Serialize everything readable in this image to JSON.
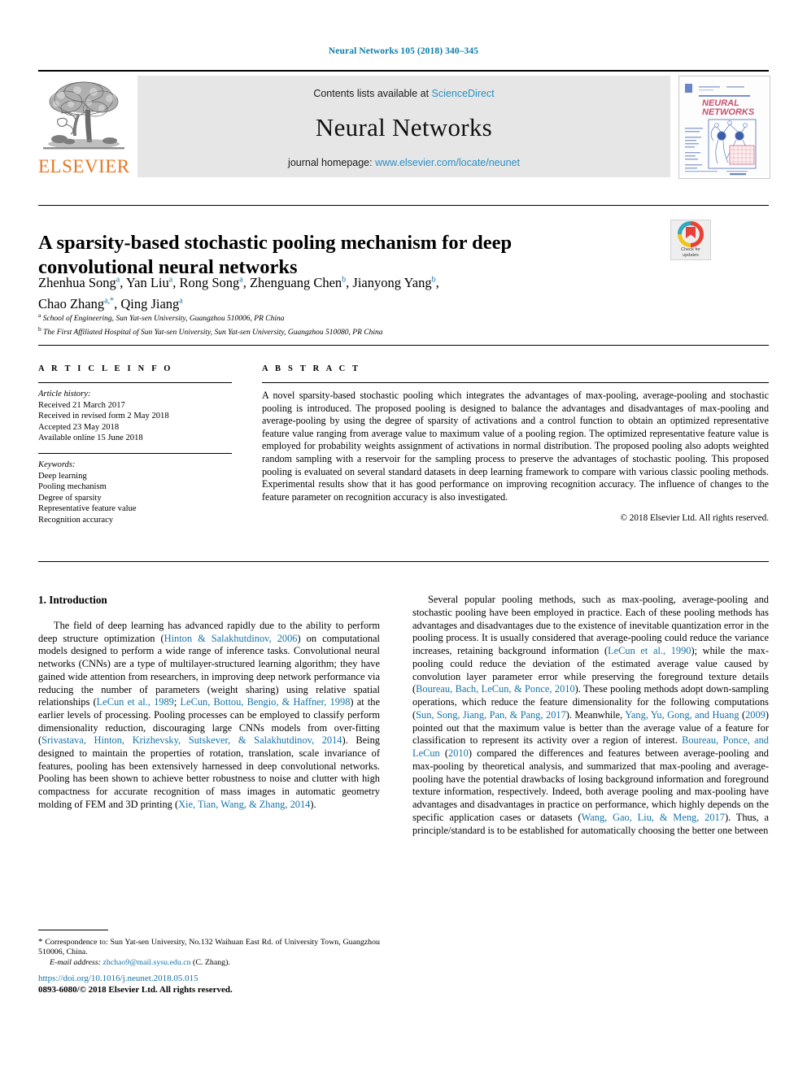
{
  "running_head": "Neural Networks 105 (2018) 340–345",
  "masthead": {
    "publisher_name": "ELSEVIER",
    "contents_prefix": "Contents lists available at",
    "contents_link": "ScienceDirect",
    "journal_title": "Neural Networks",
    "homepage_prefix": "journal homepage:",
    "homepage_link": "www.elsevier.com/locate/neunet",
    "cover": {
      "title_line1": "NEURAL",
      "title_line2": "NETWORKS",
      "accent_color": "#c94f6d",
      "frame_color": "#6b86c4"
    }
  },
  "title": "A sparsity-based stochastic pooling mechanism for deep convolutional neural networks",
  "authors_line1": "Zhenhua Song a, Yan Liu a, Rong Song a, Zhenguang Chen b, Jianyong Yang b,",
  "authors_line2": "Chao Zhang a,*, Qing Jiang a",
  "authors": [
    {
      "name": "Zhenhua Song",
      "marks": "a"
    },
    {
      "name": "Yan Liu",
      "marks": "a"
    },
    {
      "name": "Rong Song",
      "marks": "a"
    },
    {
      "name": "Zhenguang Chen",
      "marks": "b"
    },
    {
      "name": "Jianyong Yang",
      "marks": "b"
    },
    {
      "name": "Chao Zhang",
      "marks": "a,*"
    },
    {
      "name": "Qing Jiang",
      "marks": "a"
    }
  ],
  "affiliations": [
    {
      "mark": "a",
      "text": "School of Engineering, Sun Yat-sen University, Guangzhou 510006, PR China"
    },
    {
      "mark": "b",
      "text": "The First Affiliated Hospital of Sun Yat-sen University, Sun Yat-sen University, Guangzhou 510080, PR China"
    }
  ],
  "crossmark": {
    "label_line1": "Check for",
    "label_line2": "updates"
  },
  "article_info": {
    "heading": "A R T I C L E   I N F O",
    "history_label": "Article history:",
    "history": [
      "Received 21 March 2017",
      "Received in revised form 2 May 2018",
      "Accepted 23 May 2018",
      "Available online 15 June 2018"
    ],
    "keywords_label": "Keywords:",
    "keywords": [
      "Deep learning",
      "Pooling mechanism",
      "Degree of sparsity",
      "Representative feature value",
      "Recognition accuracy"
    ]
  },
  "abstract": {
    "heading": "A B S T R A C T",
    "text": "A novel sparsity-based stochastic pooling which integrates the advantages of max-pooling, average-pooling and stochastic pooling is introduced. The proposed pooling is designed to balance the advantages and disadvantages of max-pooling and average-pooling by using the degree of sparsity of activations and a control function to obtain an optimized representative feature value ranging from average value to maximum value of a pooling region. The optimized representative feature value is employed for probability weights assignment of activations in normal distribution. The proposed pooling also adopts weighted random sampling with a reservoir for the sampling process to preserve the advantages of stochastic pooling. This proposed pooling is evaluated on several standard datasets in deep learning framework to compare with various classic pooling methods. Experimental results show that it has good performance on improving recognition accuracy. The influence of changes to the feature parameter on recognition accuracy is also investigated.",
    "copyright": "© 2018 Elsevier Ltd. All rights reserved."
  },
  "body": {
    "section_number_title": "1. Introduction",
    "left_paragraph_html": "The field of deep learning has advanced rapidly due to the ability to perform deep structure optimization (<span class=\"ref\">Hinton &amp; Salakhutdinov, 2006</span>) on computational models designed to perform a wide range of inference tasks. Convolutional neural networks (CNNs) are a type of multilayer-structured learning algorithm; they have gained wide attention from researchers, in improving deep network performance via reducing the number of parameters (weight sharing) using relative spatial relationships (<span class=\"ref\">LeCun et al., 1989</span>; <span class=\"ref\">LeCun, Bottou, Bengio, &amp; Haffner, 1998</span>) at the earlier levels of processing. Pooling processes can be employed to classify perform dimensionality reduction, discouraging large CNNs models from over-fitting (<span class=\"ref\">Srivastava, Hinton, Krizhevsky, Sutskever, &amp; Salakhutdinov, 2014</span>). Being designed to maintain the properties of rotation, translation, scale invariance of features, pooling has been extensively harnessed in deep convolutional networks. Pooling has been shown to achieve better robustness to noise and clutter with high compactness for accurate recognition of mass images in automatic geometry molding of FEM and 3D printing (<span class=\"ref\">Xie, Tian, Wang, &amp; Zhang, 2014</span>).",
    "right_paragraph_html": "Several popular pooling methods, such as max-pooling, average-pooling and stochastic pooling have been employed in practice. Each of these pooling methods has advantages and disadvantages due to the existence of inevitable quantization error in the pooling process. It is usually considered that average-pooling could reduce the variance increases, retaining background information (<span class=\"ref\">LeCun et al., 1990</span>); while the max-pooling could reduce the deviation of the estimated average value caused by convolution layer parameter error while preserving the foreground texture details (<span class=\"ref\">Boureau, Bach, LeCun, &amp; Ponce, 2010</span>). These pooling methods adopt down-sampling operations, which reduce the feature dimensionality for the following computations (<span class=\"ref\">Sun, Song, Jiang, Pan, &amp; Pang, 2017</span>). Meanwhile, <span class=\"ref\">Yang, Yu, Gong, and Huang</span> (<span class=\"ref\">2009</span>) pointed out that the maximum value is better than the average value of a feature for classification to represent its activity over a region of interest. <span class=\"ref\">Boureau, Ponce, and LeCun</span> (<span class=\"ref\">2010</span>) compared the differences and features between average-pooling and max-pooling by theoretical analysis, and summarized that max-pooling and average-pooling have the potential drawbacks of losing background information and foreground texture information, respectively. Indeed, both average pooling and max-pooling have advantages and disadvantages in practice on performance, which highly depends on the specific application cases or datasets (<span class=\"ref\">Wang, Gao, Liu, &amp; Meng, 2017</span>). Thus, a principle/standard is to be established for automatically choosing the better one between"
  },
  "footnote": {
    "correspondence_html": "<span class=\"star\">*</span> Correspondence to: Sun Yat-sen University, No.132 Waihuan East Rd. of University Town, Guangzhou 510006, China.",
    "email_label": "E-mail address:",
    "email": "zhchao9@mail.sysu.edu.cn",
    "email_suffix": "(C. Zhang)."
  },
  "footer": {
    "doi": "https://doi.org/10.1016/j.neunet.2018.05.015",
    "issn_line": "0893-6080/© 2018 Elsevier Ltd. All rights reserved."
  },
  "colors": {
    "link_blue": "#1573a8",
    "header_blue": "#0b7ca8",
    "elsevier_orange": "#e87722",
    "band_gray": "#e6e6e6"
  }
}
